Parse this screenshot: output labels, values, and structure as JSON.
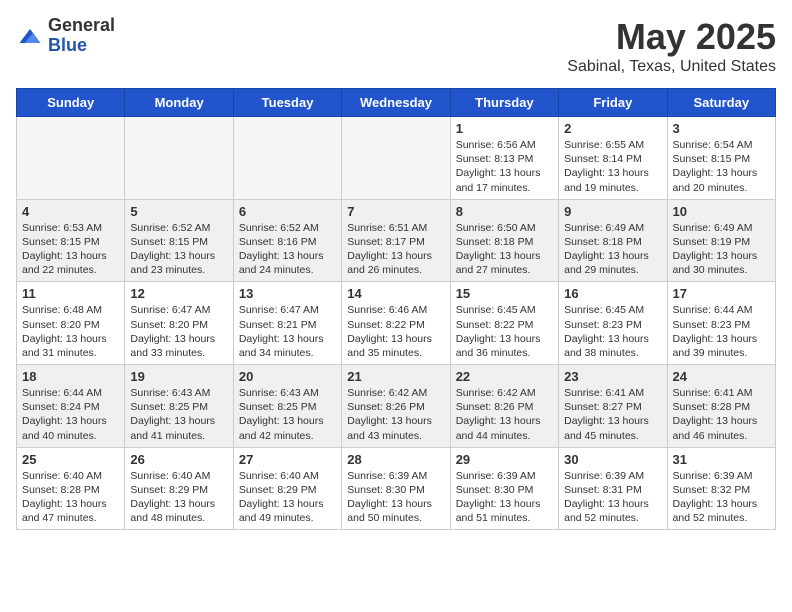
{
  "logo": {
    "general": "General",
    "blue": "Blue"
  },
  "header": {
    "month": "May 2025",
    "location": "Sabinal, Texas, United States"
  },
  "weekdays": [
    "Sunday",
    "Monday",
    "Tuesday",
    "Wednesday",
    "Thursday",
    "Friday",
    "Saturday"
  ],
  "weeks": [
    [
      {
        "day": "",
        "sunrise": "",
        "sunset": "",
        "daylight": ""
      },
      {
        "day": "",
        "sunrise": "",
        "sunset": "",
        "daylight": ""
      },
      {
        "day": "",
        "sunrise": "",
        "sunset": "",
        "daylight": ""
      },
      {
        "day": "",
        "sunrise": "",
        "sunset": "",
        "daylight": ""
      },
      {
        "day": "1",
        "sunrise": "Sunrise: 6:56 AM",
        "sunset": "Sunset: 8:13 PM",
        "daylight": "Daylight: 13 hours and 17 minutes."
      },
      {
        "day": "2",
        "sunrise": "Sunrise: 6:55 AM",
        "sunset": "Sunset: 8:14 PM",
        "daylight": "Daylight: 13 hours and 19 minutes."
      },
      {
        "day": "3",
        "sunrise": "Sunrise: 6:54 AM",
        "sunset": "Sunset: 8:15 PM",
        "daylight": "Daylight: 13 hours and 20 minutes."
      }
    ],
    [
      {
        "day": "4",
        "sunrise": "Sunrise: 6:53 AM",
        "sunset": "Sunset: 8:15 PM",
        "daylight": "Daylight: 13 hours and 22 minutes."
      },
      {
        "day": "5",
        "sunrise": "Sunrise: 6:52 AM",
        "sunset": "Sunset: 8:15 PM",
        "daylight": "Daylight: 13 hours and 23 minutes."
      },
      {
        "day": "6",
        "sunrise": "Sunrise: 6:52 AM",
        "sunset": "Sunset: 8:16 PM",
        "daylight": "Daylight: 13 hours and 24 minutes."
      },
      {
        "day": "7",
        "sunrise": "Sunrise: 6:51 AM",
        "sunset": "Sunset: 8:17 PM",
        "daylight": "Daylight: 13 hours and 26 minutes."
      },
      {
        "day": "8",
        "sunrise": "Sunrise: 6:50 AM",
        "sunset": "Sunset: 8:18 PM",
        "daylight": "Daylight: 13 hours and 27 minutes."
      },
      {
        "day": "9",
        "sunrise": "Sunrise: 6:49 AM",
        "sunset": "Sunset: 8:18 PM",
        "daylight": "Daylight: 13 hours and 29 minutes."
      },
      {
        "day": "10",
        "sunrise": "Sunrise: 6:49 AM",
        "sunset": "Sunset: 8:19 PM",
        "daylight": "Daylight: 13 hours and 30 minutes."
      }
    ],
    [
      {
        "day": "11",
        "sunrise": "Sunrise: 6:48 AM",
        "sunset": "Sunset: 8:20 PM",
        "daylight": "Daylight: 13 hours and 31 minutes."
      },
      {
        "day": "12",
        "sunrise": "Sunrise: 6:47 AM",
        "sunset": "Sunset: 8:20 PM",
        "daylight": "Daylight: 13 hours and 33 minutes."
      },
      {
        "day": "13",
        "sunrise": "Sunrise: 6:47 AM",
        "sunset": "Sunset: 8:21 PM",
        "daylight": "Daylight: 13 hours and 34 minutes."
      },
      {
        "day": "14",
        "sunrise": "Sunrise: 6:46 AM",
        "sunset": "Sunset: 8:22 PM",
        "daylight": "Daylight: 13 hours and 35 minutes."
      },
      {
        "day": "15",
        "sunrise": "Sunrise: 6:45 AM",
        "sunset": "Sunset: 8:22 PM",
        "daylight": "Daylight: 13 hours and 36 minutes."
      },
      {
        "day": "16",
        "sunrise": "Sunrise: 6:45 AM",
        "sunset": "Sunset: 8:23 PM",
        "daylight": "Daylight: 13 hours and 38 minutes."
      },
      {
        "day": "17",
        "sunrise": "Sunrise: 6:44 AM",
        "sunset": "Sunset: 8:23 PM",
        "daylight": "Daylight: 13 hours and 39 minutes."
      }
    ],
    [
      {
        "day": "18",
        "sunrise": "Sunrise: 6:44 AM",
        "sunset": "Sunset: 8:24 PM",
        "daylight": "Daylight: 13 hours and 40 minutes."
      },
      {
        "day": "19",
        "sunrise": "Sunrise: 6:43 AM",
        "sunset": "Sunset: 8:25 PM",
        "daylight": "Daylight: 13 hours and 41 minutes."
      },
      {
        "day": "20",
        "sunrise": "Sunrise: 6:43 AM",
        "sunset": "Sunset: 8:25 PM",
        "daylight": "Daylight: 13 hours and 42 minutes."
      },
      {
        "day": "21",
        "sunrise": "Sunrise: 6:42 AM",
        "sunset": "Sunset: 8:26 PM",
        "daylight": "Daylight: 13 hours and 43 minutes."
      },
      {
        "day": "22",
        "sunrise": "Sunrise: 6:42 AM",
        "sunset": "Sunset: 8:26 PM",
        "daylight": "Daylight: 13 hours and 44 minutes."
      },
      {
        "day": "23",
        "sunrise": "Sunrise: 6:41 AM",
        "sunset": "Sunset: 8:27 PM",
        "daylight": "Daylight: 13 hours and 45 minutes."
      },
      {
        "day": "24",
        "sunrise": "Sunrise: 6:41 AM",
        "sunset": "Sunset: 8:28 PM",
        "daylight": "Daylight: 13 hours and 46 minutes."
      }
    ],
    [
      {
        "day": "25",
        "sunrise": "Sunrise: 6:40 AM",
        "sunset": "Sunset: 8:28 PM",
        "daylight": "Daylight: 13 hours and 47 minutes."
      },
      {
        "day": "26",
        "sunrise": "Sunrise: 6:40 AM",
        "sunset": "Sunset: 8:29 PM",
        "daylight": "Daylight: 13 hours and 48 minutes."
      },
      {
        "day": "27",
        "sunrise": "Sunrise: 6:40 AM",
        "sunset": "Sunset: 8:29 PM",
        "daylight": "Daylight: 13 hours and 49 minutes."
      },
      {
        "day": "28",
        "sunrise": "Sunrise: 6:39 AM",
        "sunset": "Sunset: 8:30 PM",
        "daylight": "Daylight: 13 hours and 50 minutes."
      },
      {
        "day": "29",
        "sunrise": "Sunrise: 6:39 AM",
        "sunset": "Sunset: 8:30 PM",
        "daylight": "Daylight: 13 hours and 51 minutes."
      },
      {
        "day": "30",
        "sunrise": "Sunrise: 6:39 AM",
        "sunset": "Sunset: 8:31 PM",
        "daylight": "Daylight: 13 hours and 52 minutes."
      },
      {
        "day": "31",
        "sunrise": "Sunrise: 6:39 AM",
        "sunset": "Sunset: 8:32 PM",
        "daylight": "Daylight: 13 hours and 52 minutes."
      }
    ]
  ]
}
